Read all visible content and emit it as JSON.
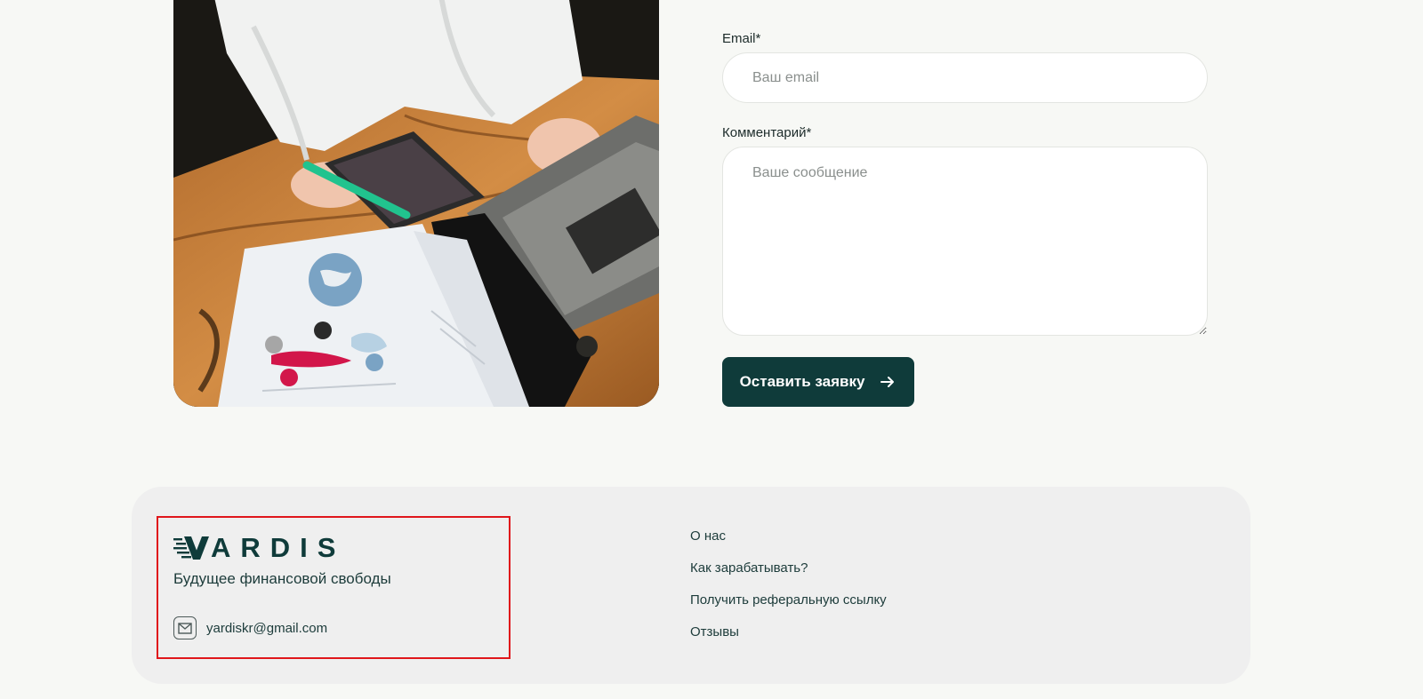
{
  "form": {
    "email_label": "Email*",
    "email_placeholder": "Ваш email",
    "comment_label": "Комментарий*",
    "comment_placeholder": "Ваше сообщение",
    "submit_label": "Оставить заявку"
  },
  "footer": {
    "logo_text": "ARDIS",
    "tagline": "Будущее финансовой свободы",
    "email": "yardiskr@gmail.com",
    "nav": [
      {
        "label": "О нас"
      },
      {
        "label": "Как зарабатывать?"
      },
      {
        "label": "Получить реферальную ссылку"
      },
      {
        "label": "Отзывы"
      }
    ]
  },
  "colors": {
    "page_background": "#f7f8f5",
    "footer_background": "#efefef",
    "brand_dark_green": "#0f3b3a",
    "highlight_border": "#e0161b"
  },
  "icons": {
    "submit": "arrow-right-icon",
    "email": "mail-icon",
    "logo": "speed-v-logo-mark"
  }
}
